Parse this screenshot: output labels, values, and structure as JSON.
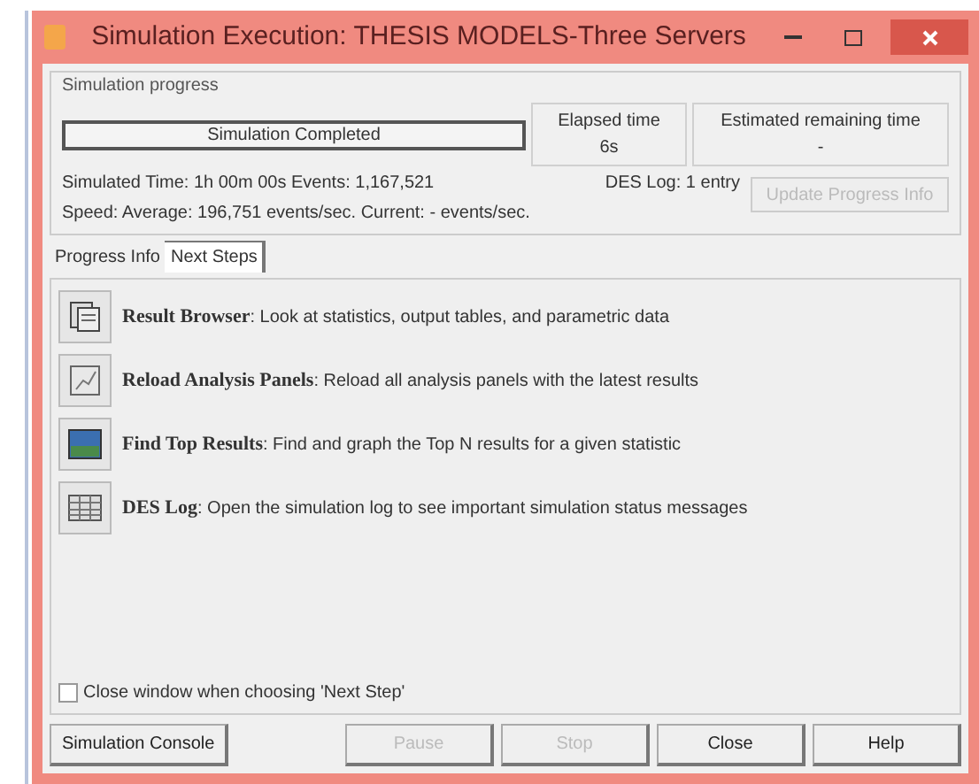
{
  "window": {
    "title": "Simulation Execution: THESIS MODELS-Three Servers"
  },
  "progress": {
    "group_title": "Simulation progress",
    "status": "Simulation Completed",
    "elapsed_label": "Elapsed time",
    "elapsed_value": "6s",
    "remaining_label": "Estimated remaining time",
    "remaining_value": "-",
    "simulated_line": "Simulated Time: 1h 00m 00s Events: 1,167,521",
    "speed_line": "Speed: Average: 196,751 events/sec. Current: - events/sec.",
    "des_log": "DES Log: 1 entry",
    "update_button": {
      "label": "Update Progress Info",
      "disabled": true
    }
  },
  "tabs": [
    {
      "label": "Progress Info",
      "selected": false
    },
    {
      "label": "Next Steps",
      "selected": true
    }
  ],
  "steps": [
    {
      "kind": "browser",
      "title": "Result Browser",
      "description": ": Look at statistics, output tables, and parametric data"
    },
    {
      "kind": "reload",
      "title": "Reload Analysis Panels",
      "description": ": Reload all analysis panels with the latest results"
    },
    {
      "kind": "top",
      "title": "Find Top Results",
      "description": ": Find and graph the Top N results for a given statistic"
    },
    {
      "kind": "log",
      "title": "DES Log",
      "description": ": Open the simulation log to see important simulation status messages"
    }
  ],
  "close_option": {
    "label": "Close window when choosing 'Next Step'",
    "checked": false
  },
  "buttons": [
    {
      "label": "Simulation Console",
      "disabled": false
    },
    {
      "label": "Pause",
      "disabled": true
    },
    {
      "label": "Stop",
      "disabled": true
    },
    {
      "label": "Close",
      "disabled": false
    },
    {
      "label": "Help",
      "disabled": false
    }
  ]
}
